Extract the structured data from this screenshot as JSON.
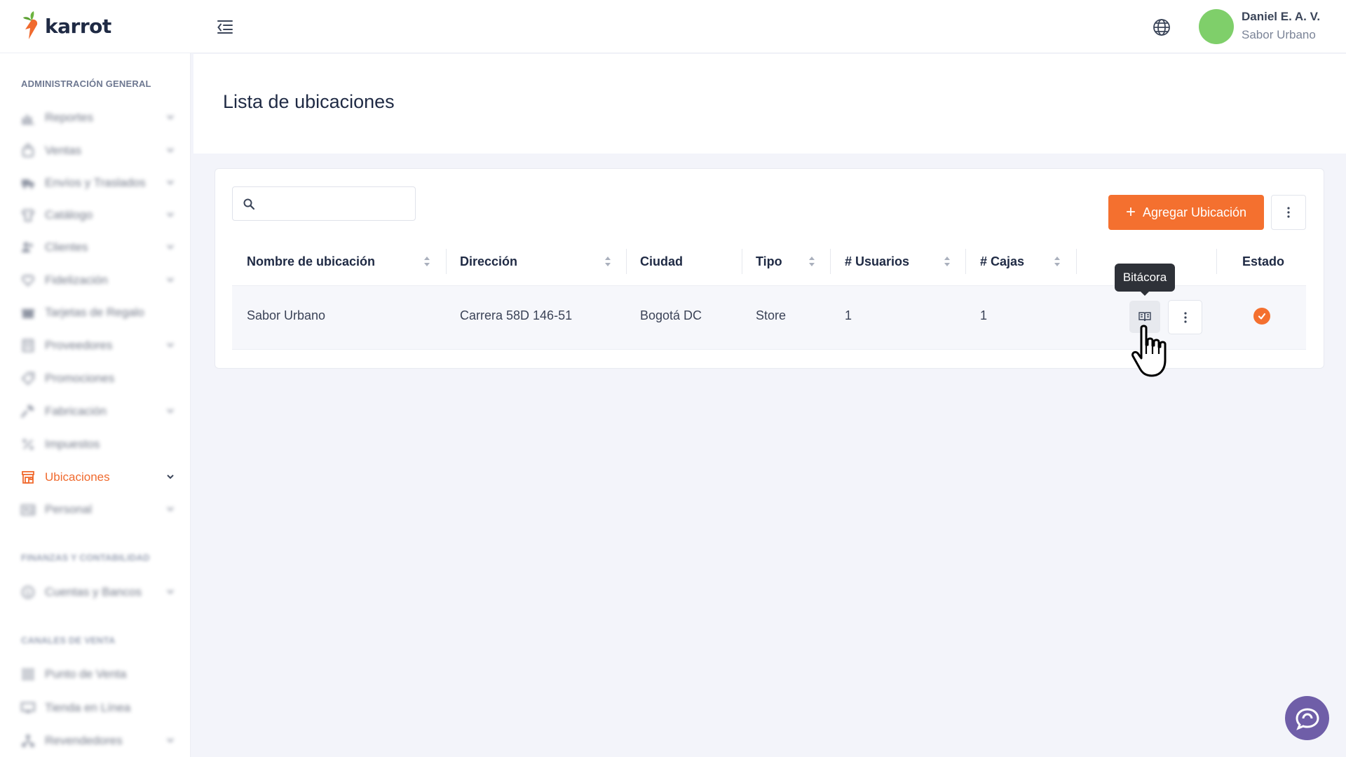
{
  "brand": {
    "name": "karrot",
    "accent": "#f4702f"
  },
  "user": {
    "name": "Daniel E. A. V.",
    "org": "Sabor Urbano",
    "avatar_color": "#7fcf6a"
  },
  "sidebar": {
    "sections": [
      {
        "title": "ADMINISTRACIÓN GENERAL"
      },
      {
        "title": "FINANZAS Y CONTABILIDAD"
      },
      {
        "title": "CANALES DE VENTA"
      }
    ],
    "items": [
      {
        "label": "Reportes",
        "icon": "chart-icon"
      },
      {
        "label": "Ventas",
        "icon": "bag-icon"
      },
      {
        "label": "Envíos y Traslados",
        "icon": "truck-icon"
      },
      {
        "label": "Catálogo",
        "icon": "shirt-icon"
      },
      {
        "label": "Clientes",
        "icon": "users-icon"
      },
      {
        "label": "Fidelización",
        "icon": "heart-icon"
      },
      {
        "label": "Tarjetas de Regalo",
        "icon": "gift-icon"
      },
      {
        "label": "Proveedores",
        "icon": "building-icon"
      },
      {
        "label": "Promociones",
        "icon": "tag-icon"
      },
      {
        "label": "Fabricación",
        "icon": "hammer-icon"
      },
      {
        "label": "Impuestos",
        "icon": "percent-icon"
      },
      {
        "label": "Ubicaciones",
        "icon": "store-icon"
      },
      {
        "label": "Personal",
        "icon": "id-card-icon"
      },
      {
        "label": "Cuentas y Bancos",
        "icon": "dollar-icon"
      },
      {
        "label": "Punto de Venta",
        "icon": "grid-icon"
      },
      {
        "label": "Tienda en Línea",
        "icon": "monitor-icon"
      },
      {
        "label": "Revendedores",
        "icon": "network-icon"
      }
    ]
  },
  "page": {
    "title": "Lista de ubicaciones"
  },
  "toolbar": {
    "search_placeholder": "",
    "add_label": "Agregar Ubicación"
  },
  "table": {
    "headers": [
      "Nombre de ubicación",
      "Dirección",
      "Ciudad",
      "Tipo",
      "# Usuarios",
      "# Cajas",
      "Estado"
    ],
    "rows": [
      {
        "nombre": "Sabor Urbano",
        "direccion": "Carrera 58D 146-51",
        "ciudad": "Bogotá DC",
        "tipo": "Store",
        "usuarios": "1",
        "cajas": "1",
        "estado": "active"
      }
    ]
  },
  "tooltip": {
    "text": "Bitácora"
  }
}
